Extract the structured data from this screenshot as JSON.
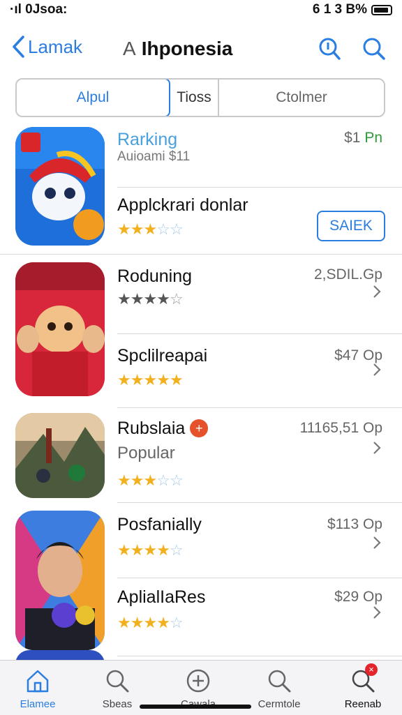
{
  "status": {
    "time": "·ıl 0Jsoa:",
    "right": "6 1 3 B%"
  },
  "nav": {
    "back_label": "Lamak",
    "title_prefix": "A",
    "title": "Ihponesia"
  },
  "segments": [
    "Alpul",
    "Tioss",
    "Ctolmer"
  ],
  "apps": [
    {
      "name": "Rarking",
      "subtitle": "Auioami $11",
      "price": "$1",
      "price_suffix": "Pn",
      "name2": "Applckrari donlar",
      "stars": 3,
      "action": "SAIEK"
    },
    {
      "name": "Roduning",
      "price": "2,SDIL.Gp",
      "stars": 4
    },
    {
      "name": "Spclilreapai",
      "price": "$47 Op",
      "stars": 4.5
    },
    {
      "name": "Rubslaia",
      "subtitle": "Popular",
      "price": "11165,51 Op",
      "stars": 3
    },
    {
      "name": "Posfanially",
      "price": "$113 Op",
      "stars": 3.5
    },
    {
      "name": "AplialIaRes",
      "price": "$29 Op",
      "stars": 4
    }
  ],
  "tabs": [
    "Elamee",
    "Sbeas",
    "Cawala",
    "Cermtole",
    "Reenab"
  ],
  "colors": {
    "accent": "#2a7de1",
    "star": "#f2b01e",
    "badge": "#e3252b"
  }
}
